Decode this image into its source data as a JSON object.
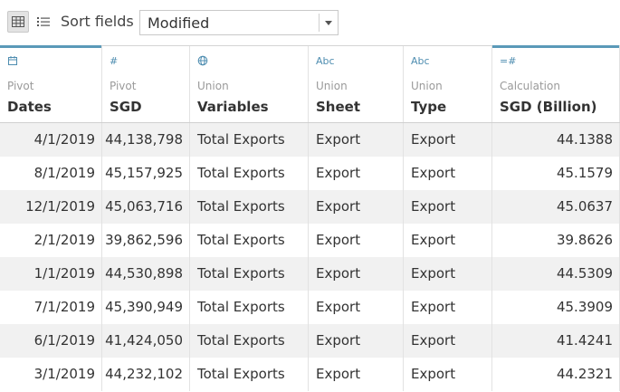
{
  "toolbar": {
    "grid_view_icon": "grid-view-icon",
    "list_view_icon": "list-view-icon",
    "sort_label": "Sort fields",
    "sort_value": "Modified"
  },
  "columns": [
    {
      "icon": "calendar-icon",
      "glyph": "",
      "source": "Pivot",
      "name": "Dates"
    },
    {
      "icon": "number-icon",
      "glyph": "#",
      "source": "Pivot",
      "name": "SGD"
    },
    {
      "icon": "globe-icon",
      "glyph": "",
      "source": "Union",
      "name": "Variables"
    },
    {
      "icon": "string-icon",
      "glyph": "Abc",
      "source": "Union",
      "name": "Sheet"
    },
    {
      "icon": "string-icon",
      "glyph": "Abc",
      "source": "Union",
      "name": "Type"
    },
    {
      "icon": "calculated-number-icon",
      "glyph": "=#",
      "source": "Calculation",
      "name": "SGD (Billion)"
    }
  ],
  "rows": [
    [
      "4/1/2019",
      "44,138,798",
      "Total Exports",
      "Export",
      "Export",
      "44.1388"
    ],
    [
      "8/1/2019",
      "45,157,925",
      "Total Exports",
      "Export",
      "Export",
      "45.1579"
    ],
    [
      "12/1/2019",
      "45,063,716",
      "Total Exports",
      "Export",
      "Export",
      "45.0637"
    ],
    [
      "2/1/2019",
      "39,862,596",
      "Total Exports",
      "Export",
      "Export",
      "39.8626"
    ],
    [
      "1/1/2019",
      "44,530,898",
      "Total Exports",
      "Export",
      "Export",
      "44.5309"
    ],
    [
      "7/1/2019",
      "45,390,949",
      "Total Exports",
      "Export",
      "Export",
      "45.3909"
    ],
    [
      "6/1/2019",
      "41,424,050",
      "Total Exports",
      "Export",
      "Export",
      "41.4241"
    ],
    [
      "3/1/2019",
      "44,232,102",
      "Total Exports",
      "Export",
      "Export",
      "44.2321"
    ]
  ],
  "colors": {
    "accent": "#5a99b8",
    "icon": "#4e8db0",
    "alt_row": "#f1f1f1"
  }
}
